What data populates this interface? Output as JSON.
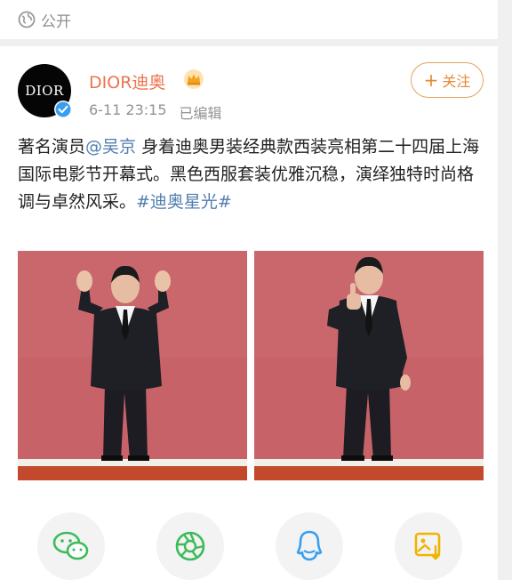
{
  "visibility": {
    "label": "公开",
    "icon": "globe-icon"
  },
  "post": {
    "author": {
      "name": "DIOR迪奥",
      "avatar_text": "DIOR",
      "badge_icon": "crown-icon",
      "verified_icon": "verified-icon"
    },
    "timestamp": "6-11 23:15",
    "edited_label": "已编辑",
    "follow": {
      "plus": "+",
      "label": "关注"
    },
    "text": {
      "before_mention": "著名演员",
      "mention": "@吴京",
      "middle": " 身着迪奥男装经典款西装亮相第二十四届上海国际电影节开幕式。黑色西服套装优雅沉稳，演绎独特时尚格调与卓然风采。",
      "topic": "#迪奥星光#"
    },
    "photos": [
      "waving-photo",
      "thumbs-up-photo"
    ]
  },
  "share": [
    {
      "name": "wechat-icon"
    },
    {
      "name": "moments-icon"
    },
    {
      "name": "qq-icon"
    },
    {
      "name": "save-image-icon"
    }
  ],
  "colors": {
    "accent_orange": "#eb7350",
    "link_blue": "#507daf",
    "follow_border": "#e1a35a",
    "wechat_green": "#3dbb5a",
    "qq_blue": "#3a9ef0",
    "save_yellow": "#f0b400",
    "backdrop_red": "#c76269"
  }
}
